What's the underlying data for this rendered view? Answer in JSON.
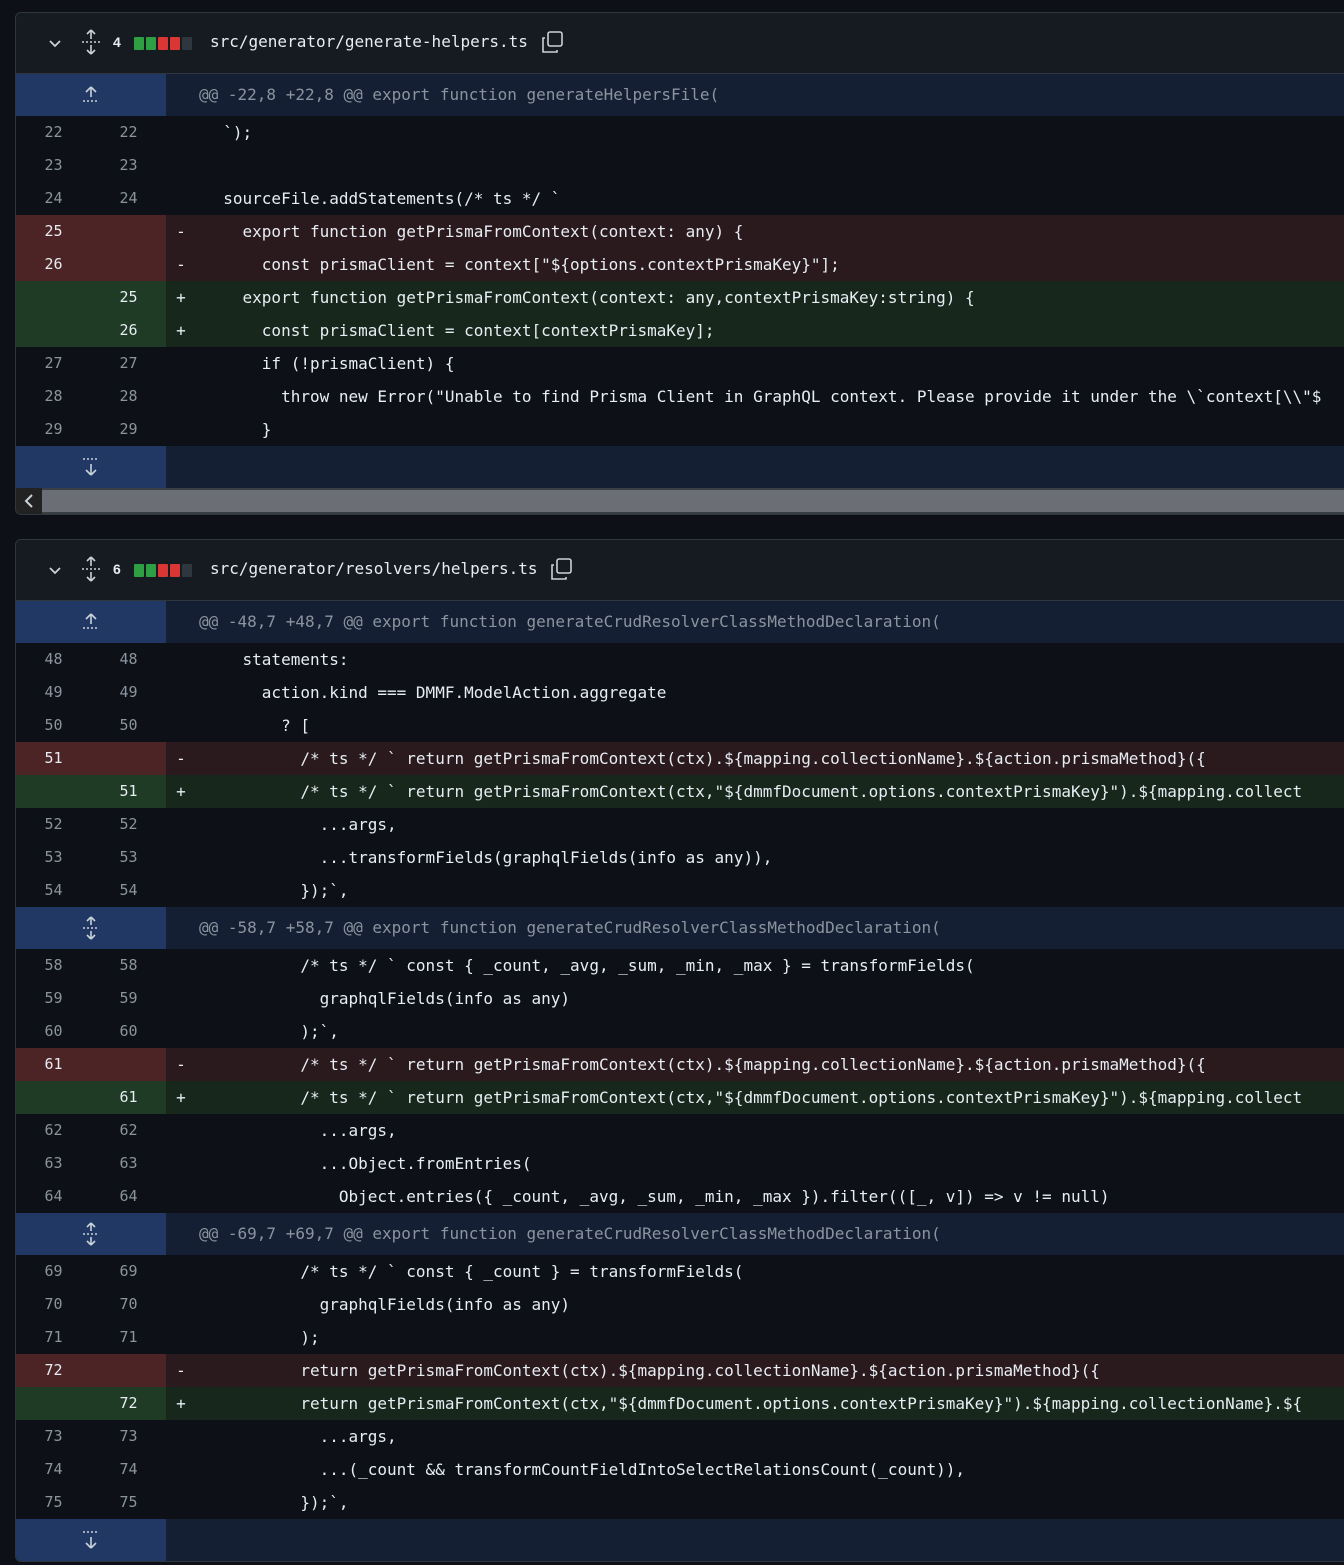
{
  "colors": {
    "green": "#2ea043",
    "red": "#da3633",
    "gray": "#30363d"
  },
  "files": [
    {
      "change_count": "4",
      "blocks": [
        "green",
        "green",
        "red",
        "red",
        "gray"
      ],
      "path": "src/generator/generate-helpers.ts",
      "hunks": [
        {
          "header": "@@ -22,8 +22,8 @@ export function generateHelpersFile(",
          "lines": [
            {
              "t": "ctx",
              "l": "22",
              "r": "22",
              "code": "  `);"
            },
            {
              "t": "ctx",
              "l": "23",
              "r": "23",
              "code": ""
            },
            {
              "t": "ctx",
              "l": "24",
              "r": "24",
              "code": "  sourceFile.addStatements(/* ts */ `"
            },
            {
              "t": "del",
              "l": "25",
              "r": "",
              "code": "    export function getPrismaFromContext(context: any) {"
            },
            {
              "t": "del",
              "l": "26",
              "r": "",
              "code": "      const prismaClient = context[\"${options.contextPrismaKey}\"];"
            },
            {
              "t": "add",
              "l": "",
              "r": "25",
              "code": "    export function getPrismaFromContext(context: any,contextPrismaKey:string) {"
            },
            {
              "t": "add",
              "l": "",
              "r": "26",
              "code": "      const prismaClient = context[contextPrismaKey];"
            },
            {
              "t": "ctx",
              "l": "27",
              "r": "27",
              "code": "      if (!prismaClient) {"
            },
            {
              "t": "ctx",
              "l": "28",
              "r": "28",
              "code": "        throw new Error(\"Unable to find Prisma Client in GraphQL context. Please provide it under the \\`context[\\\\\"$"
            },
            {
              "t": "ctx",
              "l": "29",
              "r": "29",
              "code": "      }"
            }
          ]
        }
      ]
    },
    {
      "change_count": "6",
      "blocks": [
        "green",
        "green",
        "red",
        "red",
        "gray"
      ],
      "path": "src/generator/resolvers/helpers.ts",
      "hunks": [
        {
          "header": "@@ -48,7 +48,7 @@ export function generateCrudResolverClassMethodDeclaration(",
          "lines": [
            {
              "t": "ctx",
              "l": "48",
              "r": "48",
              "code": "    statements:"
            },
            {
              "t": "ctx",
              "l": "49",
              "r": "49",
              "code": "      action.kind === DMMF.ModelAction.aggregate"
            },
            {
              "t": "ctx",
              "l": "50",
              "r": "50",
              "code": "        ? ["
            },
            {
              "t": "del",
              "l": "51",
              "r": "",
              "code": "          /* ts */ ` return getPrismaFromContext(ctx).${mapping.collectionName}.${action.prismaMethod}({"
            },
            {
              "t": "add",
              "l": "",
              "r": "51",
              "code": "          /* ts */ ` return getPrismaFromContext(ctx,\"${dmmfDocument.options.contextPrismaKey}\").${mapping.collect"
            },
            {
              "t": "ctx",
              "l": "52",
              "r": "52",
              "code": "            ...args,"
            },
            {
              "t": "ctx",
              "l": "53",
              "r": "53",
              "code": "            ...transformFields(graphqlFields(info as any)),"
            },
            {
              "t": "ctx",
              "l": "54",
              "r": "54",
              "code": "          });`,"
            }
          ]
        },
        {
          "header": "@@ -58,7 +58,7 @@ export function generateCrudResolverClassMethodDeclaration(",
          "lines": [
            {
              "t": "ctx",
              "l": "58",
              "r": "58",
              "code": "          /* ts */ ` const { _count, _avg, _sum, _min, _max } = transformFields("
            },
            {
              "t": "ctx",
              "l": "59",
              "r": "59",
              "code": "            graphqlFields(info as any)"
            },
            {
              "t": "ctx",
              "l": "60",
              "r": "60",
              "code": "          );`,"
            },
            {
              "t": "del",
              "l": "61",
              "r": "",
              "code": "          /* ts */ ` return getPrismaFromContext(ctx).${mapping.collectionName}.${action.prismaMethod}({"
            },
            {
              "t": "add",
              "l": "",
              "r": "61",
              "code": "          /* ts */ ` return getPrismaFromContext(ctx,\"${dmmfDocument.options.contextPrismaKey}\").${mapping.collect"
            },
            {
              "t": "ctx",
              "l": "62",
              "r": "62",
              "code": "            ...args,"
            },
            {
              "t": "ctx",
              "l": "63",
              "r": "63",
              "code": "            ...Object.fromEntries("
            },
            {
              "t": "ctx",
              "l": "64",
              "r": "64",
              "code": "              Object.entries({ _count, _avg, _sum, _min, _max }).filter(([_, v]) => v != null)"
            }
          ]
        },
        {
          "header": "@@ -69,7 +69,7 @@ export function generateCrudResolverClassMethodDeclaration(",
          "lines": [
            {
              "t": "ctx",
              "l": "69",
              "r": "69",
              "code": "          /* ts */ ` const { _count } = transformFields("
            },
            {
              "t": "ctx",
              "l": "70",
              "r": "70",
              "code": "            graphqlFields(info as any)"
            },
            {
              "t": "ctx",
              "l": "71",
              "r": "71",
              "code": "          );"
            },
            {
              "t": "del",
              "l": "72",
              "r": "",
              "code": "          return getPrismaFromContext(ctx).${mapping.collectionName}.${action.prismaMethod}({"
            },
            {
              "t": "add",
              "l": "",
              "r": "72",
              "code": "          return getPrismaFromContext(ctx,\"${dmmfDocument.options.contextPrismaKey}\").${mapping.collectionName}.${"
            },
            {
              "t": "ctx",
              "l": "73",
              "r": "73",
              "code": "            ...args,"
            },
            {
              "t": "ctx",
              "l": "74",
              "r": "74",
              "code": "            ...(_count && transformCountFieldIntoSelectRelationsCount(_count)),"
            },
            {
              "t": "ctx",
              "l": "75",
              "r": "75",
              "code": "          });`,"
            }
          ]
        }
      ]
    }
  ]
}
